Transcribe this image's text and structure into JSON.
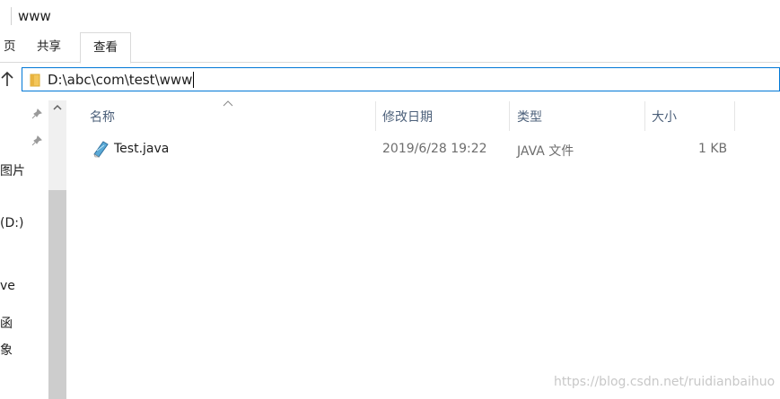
{
  "window": {
    "title": "www"
  },
  "ribbon": {
    "tabs": [
      "页",
      "共享",
      "查看"
    ]
  },
  "address": {
    "path": "D:\\abc\\com\\test\\www"
  },
  "nav": {
    "items": [
      "图片",
      "(D:)",
      "ve",
      "函",
      "象"
    ]
  },
  "file_list": {
    "columns": [
      "名称",
      "修改日期",
      "类型",
      "大小"
    ],
    "rows": [
      {
        "name": "Test.java",
        "modified": "2019/6/28 19:22",
        "type": "JAVA 文件",
        "size": "1 KB"
      }
    ]
  },
  "watermark": "https://blog.csdn.net/ruidianbaihuo",
  "icons": [
    "folder-icon",
    "up-arrow-icon",
    "pin-icon",
    "java-file-icon",
    "scroll-up-icon",
    "sort-ascending-icon"
  ]
}
